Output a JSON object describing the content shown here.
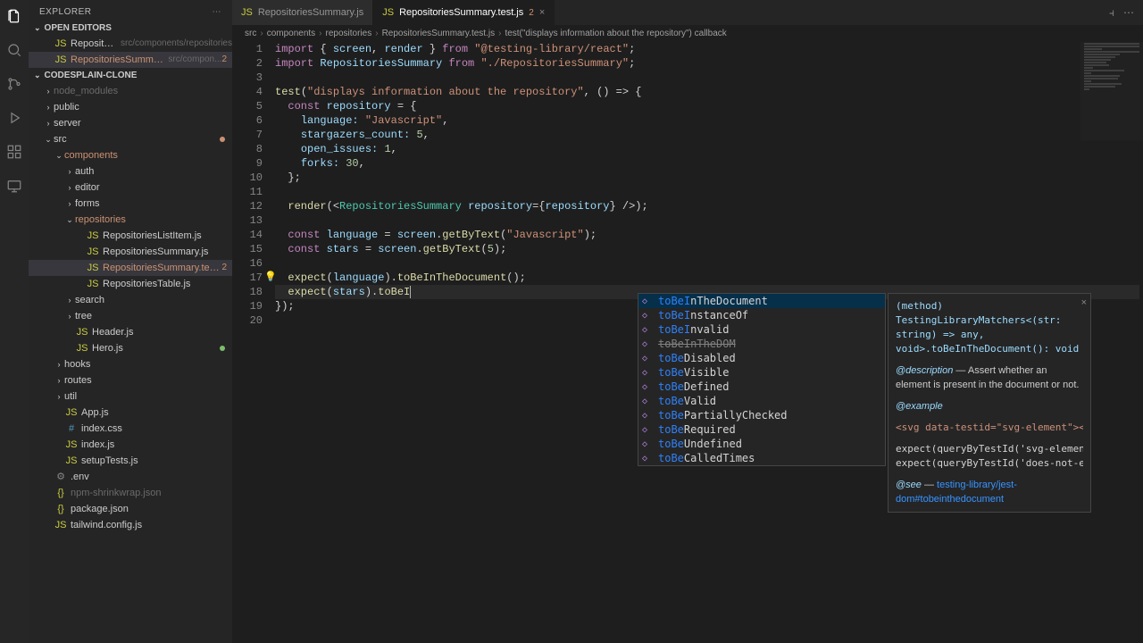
{
  "sidebar": {
    "title": "EXPLORER",
    "sections": {
      "openEditors": "OPEN EDITORS",
      "project": "CODESPLAIN-CLONE"
    },
    "openEditors": [
      {
        "name": "RepositoriesSummary.js",
        "hint": "src/components/repositories"
      },
      {
        "name": "RepositoriesSummary.test.js",
        "hint": "src/compon...",
        "badge": "2"
      }
    ],
    "tree": [
      {
        "d": 1,
        "type": "folder",
        "chev": "›",
        "label": "node_modules",
        "dim": true
      },
      {
        "d": 1,
        "type": "folder",
        "chev": "›",
        "label": "public"
      },
      {
        "d": 1,
        "type": "folder",
        "chev": "›",
        "label": "server"
      },
      {
        "d": 1,
        "type": "folder",
        "chev": "⌄",
        "label": "src",
        "dot": "orange"
      },
      {
        "d": 2,
        "type": "folder",
        "chev": "⌄",
        "label": "components",
        "orange": true
      },
      {
        "d": 3,
        "type": "folder",
        "chev": "›",
        "label": "auth"
      },
      {
        "d": 3,
        "type": "folder",
        "chev": "›",
        "label": "editor"
      },
      {
        "d": 3,
        "type": "folder",
        "chev": "›",
        "label": "forms"
      },
      {
        "d": 3,
        "type": "folder",
        "chev": "⌄",
        "label": "repositories",
        "orange": true
      },
      {
        "d": 4,
        "type": "js",
        "label": "RepositoriesListItem.js"
      },
      {
        "d": 4,
        "type": "js",
        "label": "RepositoriesSummary.js"
      },
      {
        "d": 4,
        "type": "js",
        "label": "RepositoriesSummary.test.js",
        "orange": true,
        "badge": "2",
        "selected": true
      },
      {
        "d": 4,
        "type": "js",
        "label": "RepositoriesTable.js"
      },
      {
        "d": 3,
        "type": "folder",
        "chev": "›",
        "label": "search"
      },
      {
        "d": 3,
        "type": "folder",
        "chev": "›",
        "label": "tree"
      },
      {
        "d": 3,
        "type": "js",
        "label": "Header.js"
      },
      {
        "d": 3,
        "type": "js",
        "label": "Hero.js",
        "dot": "green"
      },
      {
        "d": 2,
        "type": "folder",
        "chev": "›",
        "label": "hooks"
      },
      {
        "d": 2,
        "type": "folder",
        "chev": "›",
        "label": "routes"
      },
      {
        "d": 2,
        "type": "folder",
        "chev": "›",
        "label": "util"
      },
      {
        "d": 2,
        "type": "js",
        "label": "App.js"
      },
      {
        "d": 2,
        "type": "css",
        "label": "index.css"
      },
      {
        "d": 2,
        "type": "js",
        "label": "index.js"
      },
      {
        "d": 2,
        "type": "js",
        "label": "setupTests.js"
      },
      {
        "d": 1,
        "type": "gear",
        "label": ".env"
      },
      {
        "d": 1,
        "type": "json",
        "label": "npm-shrinkwrap.json",
        "dim": true
      },
      {
        "d": 1,
        "type": "json",
        "label": "package.json"
      },
      {
        "d": 1,
        "type": "js",
        "label": "tailwind.config.js"
      }
    ]
  },
  "tabs": [
    {
      "icon": "JS",
      "label": "RepositoriesSummary.js",
      "active": false
    },
    {
      "icon": "JS",
      "label": "RepositoriesSummary.test.js",
      "active": true,
      "badge": "2",
      "close": true
    }
  ],
  "breadcrumbs": [
    "src",
    "components",
    "repositories",
    "RepositoriesSummary.test.js",
    "test(\"displays information about the repository\") callback"
  ],
  "lineCount": 20,
  "code": {
    "l1a": "import",
    "l1b": " { ",
    "l1c": "screen",
    "l1d": ", ",
    "l1e": "render",
    "l1f": " } ",
    "l1g": "from",
    "l1h": " \"@testing-library/react\"",
    "l1i": ";",
    "l2a": "import",
    "l2b": " ",
    "l2c": "RepositoriesSummary",
    "l2d": " ",
    "l2e": "from",
    "l2f": " \"./RepositoriesSummary\"",
    "l2g": ";",
    "l4a": "test",
    "l4b": "(",
    "l4c": "\"displays information about the repository\"",
    "l4d": ", () => {",
    "l5a": "const",
    "l5b": " ",
    "l5c": "repository",
    "l5d": " = {",
    "l6a": "language:",
    "l6b": " ",
    "l6c": "\"Javascript\"",
    "l6d": ",",
    "l7a": "stargazers_count:",
    "l7b": " ",
    "l7c": "5",
    "l7d": ",",
    "l8a": "open_issues:",
    "l8b": " ",
    "l8c": "1",
    "l8d": ",",
    "l9a": "forks:",
    "l9b": " ",
    "l9c": "30",
    "l9d": ",",
    "l10": "};",
    "l12a": "render",
    "l12b": "(<",
    "l12c": "RepositoriesSummary",
    "l12d": " ",
    "l12e": "repository",
    "l12f": "={",
    "l12g": "repository",
    "l12h": "} />);",
    "l14a": "const",
    "l14b": " ",
    "l14c": "language",
    "l14d": " = ",
    "l14e": "screen",
    "l14f": ".",
    "l14g": "getByText",
    "l14h": "(",
    "l14i": "\"Javascript\"",
    "l14j": ");",
    "l15a": "const",
    "l15b": " ",
    "l15c": "stars",
    "l15d": " = ",
    "l15e": "screen",
    "l15f": ".",
    "l15g": "getByText",
    "l15h": "(",
    "l15i": "5",
    "l15j": ");",
    "l17a": "expect",
    "l17b": "(",
    "l17c": "language",
    "l17d": ").",
    "l17e": "toBeInTheDocument",
    "l17f": "();",
    "l18a": "expect",
    "l18b": "(",
    "l18c": "stars",
    "l18d": ").",
    "l18e": "toBeI",
    "l19": "});"
  },
  "suggest": {
    "typed": "toBeI",
    "items": [
      {
        "match": "toBeI",
        "rest": "nTheDocument",
        "sel": true
      },
      {
        "match": "toBeI",
        "rest": "nstanceOf"
      },
      {
        "match": "toBeI",
        "rest": "nvalid"
      },
      {
        "match": "toBeI",
        "rest": "nTheDOM",
        "depr": true
      },
      {
        "match": "toBe",
        "rest": "Disabled"
      },
      {
        "match": "toBe",
        "rest": "Visible"
      },
      {
        "match": "toBe",
        "rest": "Defined"
      },
      {
        "match": "toBe",
        "rest": "Valid"
      },
      {
        "match": "toBe",
        "rest": "PartiallyChecked"
      },
      {
        "match": "toBe",
        "rest": "Required"
      },
      {
        "match": "toBe",
        "rest": "Undefined"
      },
      {
        "match": "toBe",
        "rest": "CalledTimes"
      }
    ]
  },
  "doc": {
    "sig": "(method) TestingLibraryMatchers<(str: string) => any, void>.toBeInTheDocument(): void",
    "descTag": "@description",
    "desc": " — Assert whether an element is present in the document or not.",
    "exampleTag": "@example",
    "snip1": "<svg data-testid=\"svg-element\"></s",
    "snip2": "expect(queryByTestId('svg-element'",
    "snip3": "expect(queryByTestId('does-not-exi",
    "seeTag": "@see",
    "seeSep": " — ",
    "link": "testing-library/jest-dom#tobeinthedocument"
  }
}
